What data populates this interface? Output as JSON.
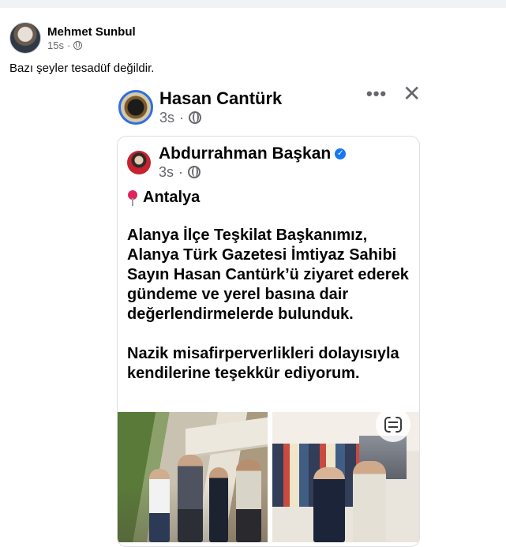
{
  "post": {
    "author": "Mehmet Sunbul",
    "timestamp": "15s",
    "visibility_icon": "globe-icon",
    "text": "Bazı şeyler tesadüf değildir."
  },
  "shared_post": {
    "author": "Hasan Cantürk",
    "timestamp": "3s",
    "visibility_icon": "globe-icon",
    "more_label": "•••",
    "close_label": "✕"
  },
  "inner_post": {
    "author": "Abdurrahman Başkan",
    "verified": true,
    "timestamp": "3s",
    "visibility_icon": "globe-icon",
    "location": "Antalya",
    "location_icon": "pin-icon",
    "paragraphs": [
      "Alanya İlçe Teşkilat Başkanımız, Alanya Türk Gazetesi İmtiyaz Sahibi Sayın Hasan Cantürk’ü ziyaret ederek gündeme ve yerel basına dair değerlendirmelerde bulunduk.",
      "Nazik misafirperverlikleri dolayısıyla kendilerine teşekkür ediyorum."
    ]
  },
  "colors": {
    "background": "#f0f2f5",
    "card": "#ffffff",
    "secondary_text": "#65676b",
    "verified": "#1877f2",
    "avatar_ring": "#2f6fe0"
  }
}
